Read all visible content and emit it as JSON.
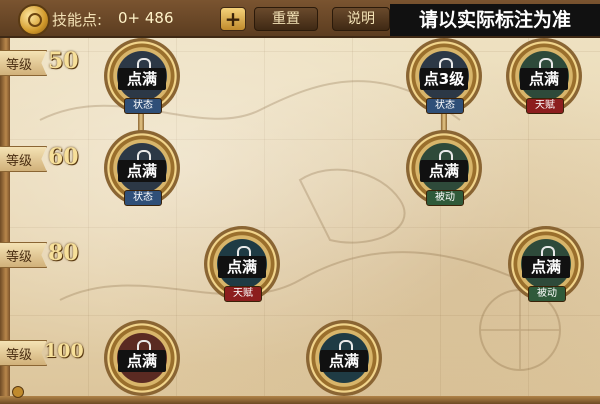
{
  "header": {
    "skill_points_label": "技能点:",
    "skill_points_value": "0+ 486",
    "plus_label": "+",
    "reset_label": "重置",
    "info_label": "说明"
  },
  "notice": "请以实际标注为准",
  "levels": [
    {
      "label": "等级",
      "value": "50"
    },
    {
      "label": "等级",
      "value": "60"
    },
    {
      "label": "等级",
      "value": "80"
    },
    {
      "label": "等级",
      "value": "100"
    }
  ],
  "skills": [
    {
      "status": "点满",
      "tag": "状态"
    },
    {
      "status": "点3级",
      "tag": "状态"
    },
    {
      "status": "点满",
      "tag": "天赋"
    },
    {
      "status": "点满",
      "tag": "状态"
    },
    {
      "status": "点满",
      "tag": "被动"
    },
    {
      "status": "点满",
      "tag": "天赋"
    },
    {
      "status": "点满",
      "tag": "被动"
    },
    {
      "status": "点满",
      "tag": ""
    },
    {
      "status": "点满",
      "tag": ""
    }
  ],
  "colors": {
    "tag_state": "#2f4f78",
    "tag_talent": "#8c1e1e",
    "tag_passive": "#2f5a3a"
  }
}
